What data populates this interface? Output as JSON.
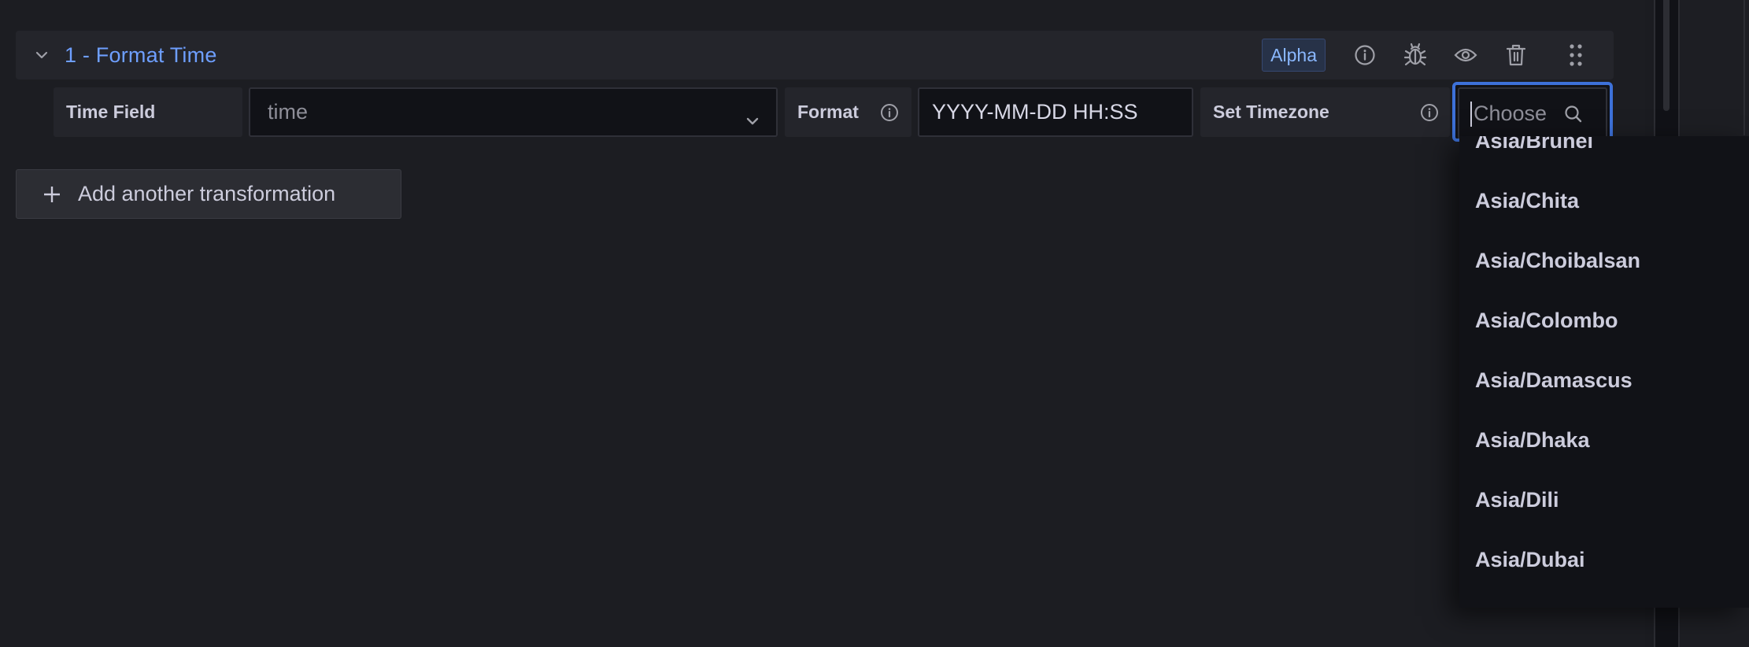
{
  "transformation": {
    "title": "1 - Format Time",
    "badge": "Alpha",
    "actions": [
      "info-icon",
      "debug-icon",
      "preview-icon",
      "delete-icon",
      "drag-handle-icon"
    ]
  },
  "fields": {
    "time_field_label": "Time Field",
    "time_field_value": "time",
    "format_label": "Format",
    "format_value": "YYYY-MM-DD HH:SS",
    "timezone_label": "Set Timezone",
    "timezone_placeholder": "Choose"
  },
  "add_button": {
    "label": "Add another transformation"
  },
  "timezone_dropdown": {
    "options": [
      "Asia/Brunei",
      "Asia/Chita",
      "Asia/Choibalsan",
      "Asia/Colombo",
      "Asia/Damascus",
      "Asia/Dhaka",
      "Asia/Dili",
      "Asia/Dubai"
    ]
  },
  "colors": {
    "accent": "#6e9fff",
    "focus_border": "#3d71d9",
    "background": "#1c1d22",
    "panel": "#24252b",
    "input": "#111217"
  }
}
